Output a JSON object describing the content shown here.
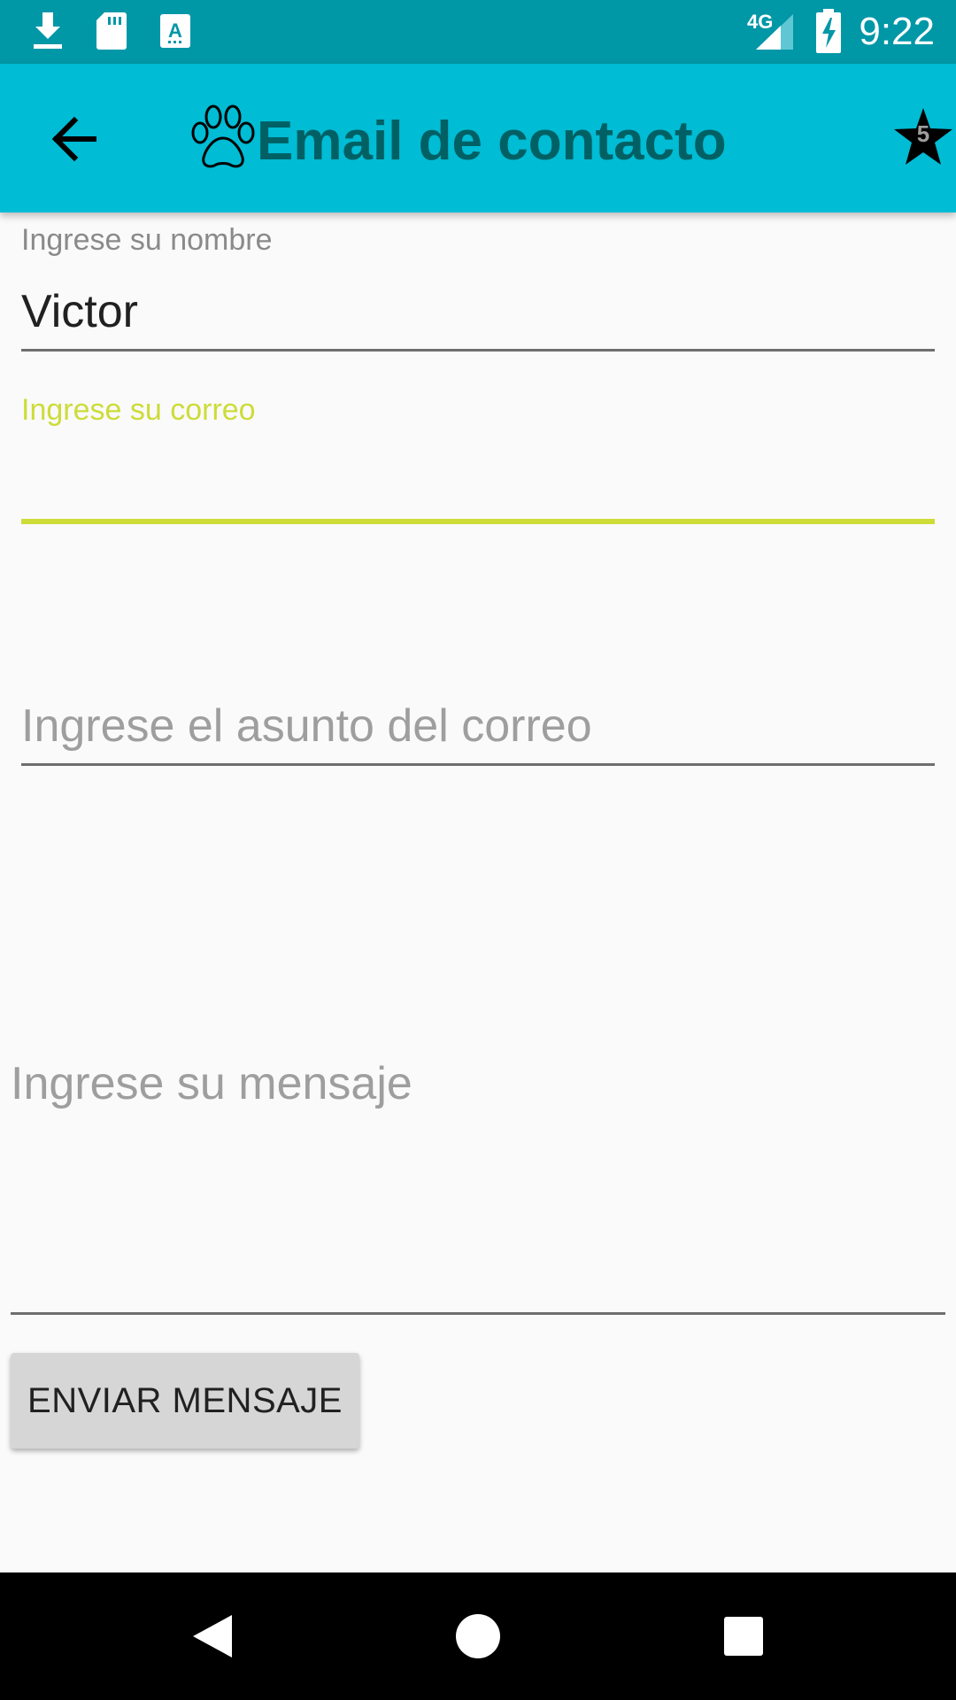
{
  "status_bar": {
    "time": "9:22",
    "network": "4G",
    "icons": [
      "download-icon",
      "sd-card-icon",
      "font-a-icon",
      "signal-4g-icon",
      "battery-charging-icon"
    ]
  },
  "toolbar": {
    "title": "Email de contacto",
    "badge_count": "5",
    "colors": {
      "background": "#00bcd4",
      "title": "#006064"
    }
  },
  "form": {
    "name": {
      "label": "Ingrese su nombre",
      "value": "Victor"
    },
    "email": {
      "label": "Ingrese su correo",
      "value": ""
    },
    "subject": {
      "placeholder": "Ingrese el asunto del correo"
    },
    "message": {
      "placeholder": "Ingrese su mensaje"
    },
    "accent_color": "#cddc39"
  },
  "send_button": {
    "label": "ENVIAR MENSAJE"
  },
  "nav_bar": {
    "buttons": [
      "back-icon",
      "home-icon",
      "recents-icon"
    ]
  }
}
